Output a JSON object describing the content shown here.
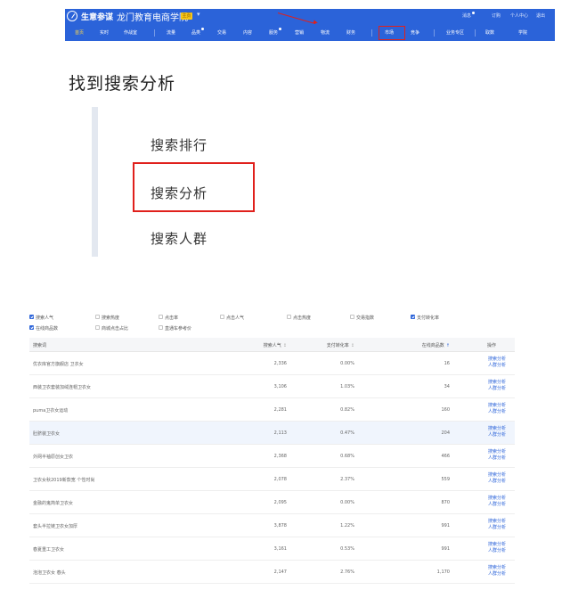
{
  "nav": {
    "brand": "生意参谋",
    "academy": "龙门教育电商学院",
    "badge": "主页",
    "utility": {
      "mail": "消息",
      "order": "订购",
      "user": "个人中心",
      "exit": "退出"
    },
    "items": [
      "首页",
      "实时",
      "作战室",
      "流量",
      "品类",
      "交易",
      "内容",
      "服务",
      "营销",
      "物流",
      "财务",
      "市场",
      "竞争",
      "业务专区",
      "取数",
      "学院"
    ],
    "selected": "市场"
  },
  "heading": "找到搜索分析",
  "submenu": {
    "items": [
      "搜索排行",
      "搜索分析",
      "搜索人群"
    ],
    "selected": "搜索分析"
  },
  "filters": [
    {
      "label": "搜索人气",
      "checked": true
    },
    {
      "label": "搜索热度",
      "checked": false
    },
    {
      "label": "点击率",
      "checked": false
    },
    {
      "label": "点击人气",
      "checked": false
    },
    {
      "label": "点击热度",
      "checked": false
    },
    {
      "label": "交易指数",
      "checked": false
    },
    {
      "label": "支付转化率",
      "checked": true
    },
    {
      "label": "在线商品数",
      "checked": true
    },
    {
      "label": "商城点击占比",
      "checked": false
    },
    {
      "label": "直通车参考价",
      "checked": false
    }
  ],
  "table": {
    "headers": {
      "keyword": "搜索词",
      "popularity": "搜索人气",
      "conversion": "支付转化率",
      "items": "在线商品数",
      "operation": "操作"
    },
    "rows": [
      {
        "keyword": "优衣库官方旗舰店 卫衣女",
        "popularity": "2,336",
        "conversion": "0.00%",
        "items": "16",
        "op1": "搜索分析",
        "op2": "人群分析"
      },
      {
        "keyword": "西装卫衣套装加绒连帽卫衣女",
        "popularity": "3,106",
        "conversion": "1.03%",
        "items": "34",
        "op1": "搜索分析",
        "op2": "人群分析"
      },
      {
        "keyword": "puma卫衣女运动",
        "popularity": "2,281",
        "conversion": "0.82%",
        "items": "160",
        "op1": "搜索分析",
        "op2": "人群分析"
      },
      {
        "keyword": "肚脐装卫衣女",
        "popularity": "2,113",
        "conversion": "0.47%",
        "items": "204",
        "op1": "搜索分析",
        "op2": "人群分析"
      },
      {
        "keyword": "外网半袖原创女卫衣",
        "popularity": "2,368",
        "conversion": "0.68%",
        "items": "466",
        "op1": "搜索分析",
        "op2": "人群分析"
      },
      {
        "keyword": "卫衣女秋2019新款宽 个性时尚",
        "popularity": "2,078",
        "conversion": "2.37%",
        "items": "559",
        "op1": "搜索分析",
        "op2": "人群分析"
      },
      {
        "keyword": "金融的鬼简单卫衣女",
        "popularity": "2,095",
        "conversion": "0.00%",
        "items": "870",
        "op1": "搜索分析",
        "op2": "人群分析"
      },
      {
        "keyword": "套头半拉链卫衣女加厚",
        "popularity": "3,878",
        "conversion": "1.22%",
        "items": "991",
        "op1": "搜索分析",
        "op2": "人群分析"
      },
      {
        "keyword": "春夏重工卫衣女",
        "popularity": "3,161",
        "conversion": "0.53%",
        "items": "991",
        "op1": "搜索分析",
        "op2": "人群分析"
      },
      {
        "keyword": "泡泡卫衣女 春头",
        "popularity": "2,147",
        "conversion": "2.76%",
        "items": "1,170",
        "op1": "搜索分析",
        "op2": "人群分析"
      }
    ]
  },
  "colors": {
    "accent": "#2b63d9",
    "highlight_box": "#e0201c",
    "nav_active": "#ffd84a"
  }
}
